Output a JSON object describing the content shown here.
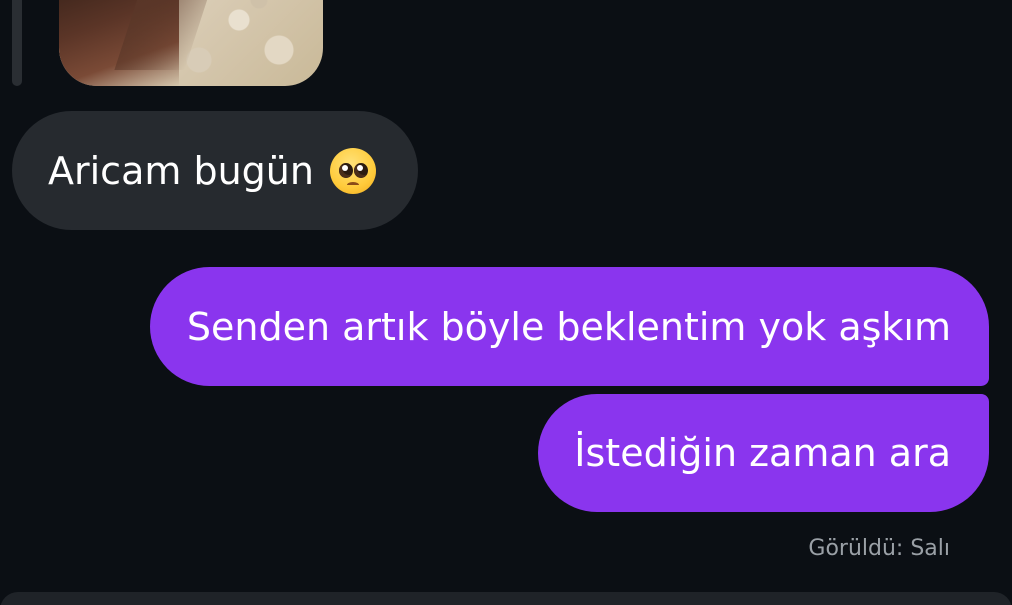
{
  "messages": [
    {
      "direction": "incoming",
      "text": "Aricam bugün",
      "emoji": "pleading-face-emoji"
    },
    {
      "direction": "outgoing",
      "text": "Senden artık böyle beklentim yok aşkım"
    },
    {
      "direction": "outgoing",
      "text": "İstediğin zaman ara"
    }
  ],
  "status": {
    "seen_label": "Görüldü: Salı"
  },
  "colors": {
    "background": "#0b0f14",
    "incoming_bubble": "#262a2f",
    "outgoing_bubble": "#8a35ee",
    "seen_text": "#9aa0a6"
  }
}
